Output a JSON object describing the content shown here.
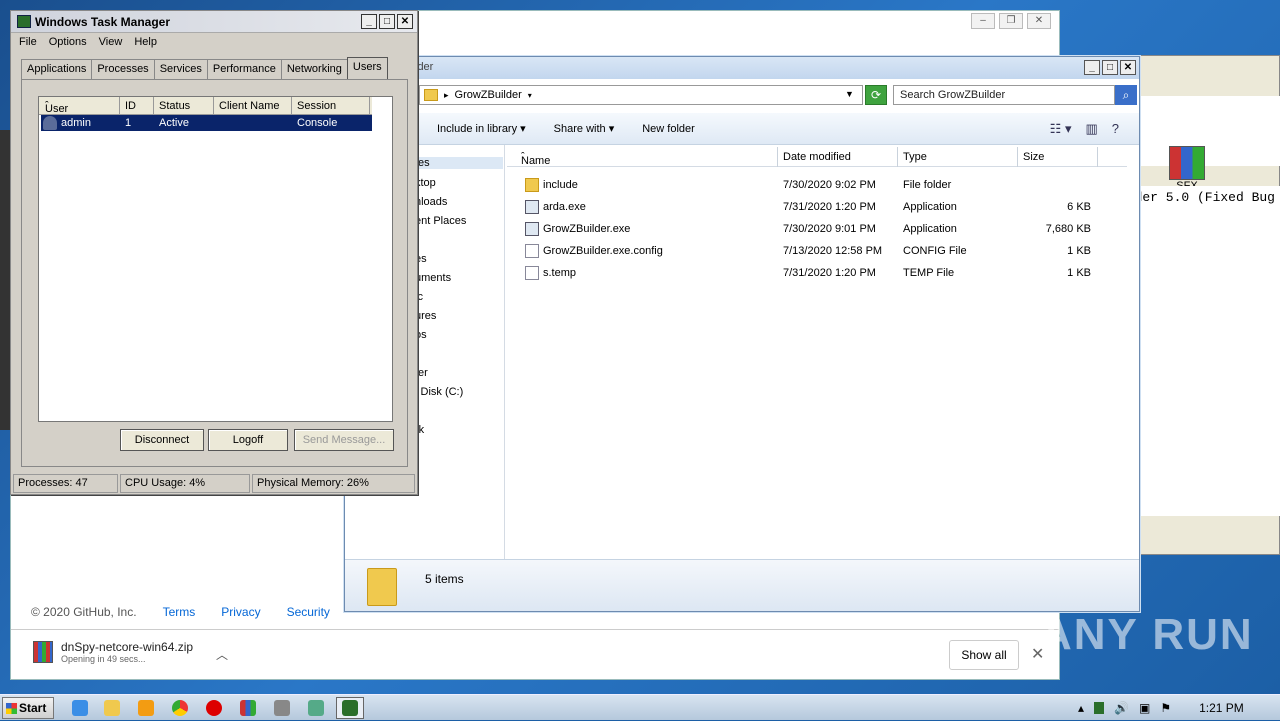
{
  "browser": {
    "footer": {
      "copyright": "© 2020 GitHub, Inc.",
      "links": [
        "Terms",
        "Privacy",
        "Security"
      ]
    },
    "download": {
      "filename": "dnSpy-netcore-win64.zip",
      "status": "Opening in 49 secs...",
      "show_all": "Show all",
      "close": "✕"
    }
  },
  "archiver": {
    "tool_label": "SFX",
    "tool_label_partial": "ent",
    "text_line": "der 5.0 (Fixed Bug"
  },
  "explorer": {
    "title_partial": "lder",
    "breadcrumb": "GrowZBuilder",
    "search_placeholder": "Search GrowZBuilder",
    "commands": [
      "Include in library",
      "Share with",
      "New folder"
    ],
    "nav_items": [
      "tes",
      "ktop",
      "nloads",
      "ent Places",
      "es",
      "uments",
      "ic",
      "ures",
      "os",
      "ter",
      "l Disk (C:)",
      "rk"
    ],
    "columns": {
      "name": "Name",
      "date": "Date modified",
      "type": "Type",
      "size": "Size"
    },
    "files": [
      {
        "name": "include",
        "date": "7/30/2020 9:02 PM",
        "type": "File folder",
        "size": "",
        "icon": "folder"
      },
      {
        "name": "arda.exe",
        "date": "7/31/2020 1:20 PM",
        "type": "Application",
        "size": "6 KB",
        "icon": "app"
      },
      {
        "name": "GrowZBuilder.exe",
        "date": "7/30/2020 9:01 PM",
        "type": "Application",
        "size": "7,680 KB",
        "icon": "app"
      },
      {
        "name": "GrowZBuilder.exe.config",
        "date": "7/13/2020 12:58 PM",
        "type": "CONFIG File",
        "size": "1 KB",
        "icon": "doc"
      },
      {
        "name": "s.temp",
        "date": "7/31/2020 1:20 PM",
        "type": "TEMP File",
        "size": "1 KB",
        "icon": "doc"
      }
    ],
    "item_count": "5 items"
  },
  "taskmgr": {
    "title": "Windows Task Manager",
    "menu": [
      "File",
      "Options",
      "View",
      "Help"
    ],
    "tabs": [
      "Applications",
      "Processes",
      "Services",
      "Performance",
      "Networking",
      "Users"
    ],
    "active_tab": "Users",
    "columns": {
      "user": "User",
      "id": "ID",
      "status": "Status",
      "client": "Client Name",
      "session": "Session"
    },
    "rows": [
      {
        "user": "admin",
        "id": "1",
        "status": "Active",
        "client": "",
        "session": "Console"
      }
    ],
    "buttons": {
      "disconnect": "Disconnect",
      "logoff": "Logoff",
      "send": "Send Message..."
    },
    "status": {
      "processes": "Processes: 47",
      "cpu": "CPU Usage: 4%",
      "memory": "Physical Memory: 26%"
    }
  },
  "taskbar": {
    "start": "Start",
    "clock": "1:21 PM"
  },
  "watermark": "ANY RUN"
}
